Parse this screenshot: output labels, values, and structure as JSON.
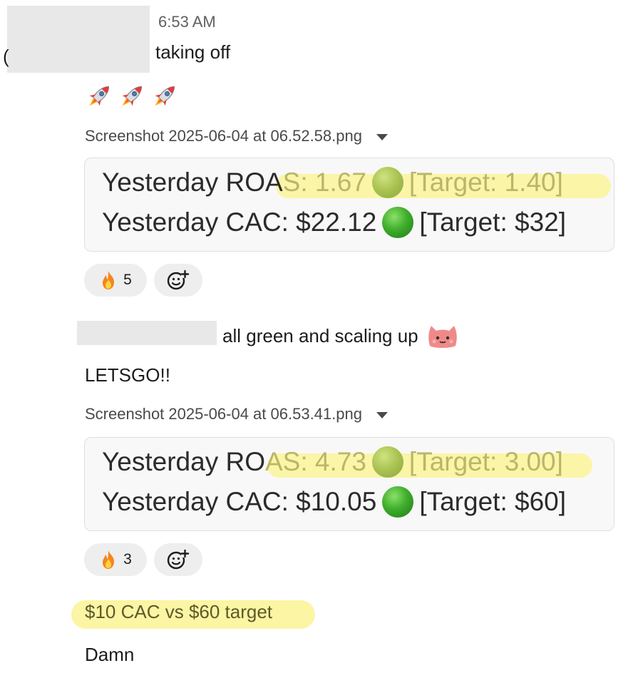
{
  "message": {
    "timestamp": "6:53 AM",
    "paren": "(",
    "text": "taking off",
    "emoji_name": "rocket-icon",
    "attachment1": {
      "filename": "Screenshot 2025-06-04 at 06.52.58.png",
      "lines": {
        "roas_a": "Yesterday ROA",
        "roas_b": "S: 1.67",
        "roas_target": "[Target: 1.40]",
        "cac_a": "Yesterday CAC: $22.12",
        "cac_target": "[Target: $32]"
      }
    },
    "reactions1": {
      "fire_count": "5"
    },
    "text2": "all green and scaling up",
    "text3": "LETSGO!!",
    "attachment2": {
      "filename": "Screenshot 2025-06-04 at 06.53.41.png",
      "lines": {
        "roas_a": "Yesterday RO",
        "roas_b": "AS: 4.73",
        "roas_target": "[Target: 3.00]",
        "cac_a": "Yesterday CAC: $10.05",
        "cac_target": "[Target: $60]"
      }
    },
    "reactions2": {
      "fire_count": "3"
    },
    "text4": "$10 CAC vs $60 target",
    "text5": "Damn"
  },
  "colors": {
    "highlight": "#fbf49a",
    "green_dot": "#3fae2c",
    "reaction_bg": "#eeeeee"
  }
}
